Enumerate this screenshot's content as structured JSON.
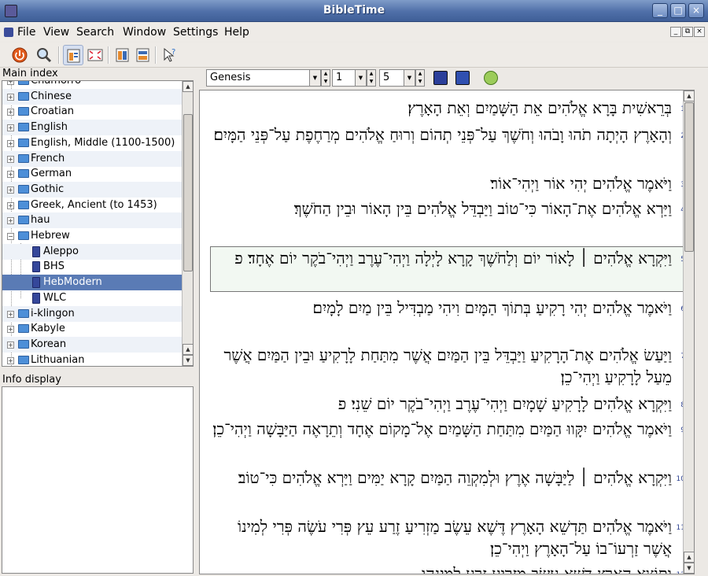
{
  "window": {
    "title": "BibleTime",
    "btn_min": "_",
    "btn_max": "□",
    "btn_close": "×"
  },
  "menubar": {
    "items": [
      "File",
      "View",
      "Search",
      "Window",
      "Settings",
      "Help"
    ],
    "mdi": [
      "_",
      "⧉",
      "×"
    ]
  },
  "main_index": {
    "label": "Main index",
    "items": [
      {
        "label": "Chamorro",
        "type": "folder"
      },
      {
        "label": "Chinese",
        "type": "folder"
      },
      {
        "label": "Croatian",
        "type": "folder"
      },
      {
        "label": "English",
        "type": "folder"
      },
      {
        "label": "English, Middle (1100-1500)",
        "type": "folder"
      },
      {
        "label": "French",
        "type": "folder"
      },
      {
        "label": "German",
        "type": "folder"
      },
      {
        "label": "Gothic",
        "type": "folder"
      },
      {
        "label": "Greek, Ancient (to 1453)",
        "type": "folder"
      },
      {
        "label": "hau",
        "type": "folder"
      },
      {
        "label": "Hebrew",
        "type": "folder",
        "expanded": true
      },
      {
        "label": "Aleppo",
        "type": "module"
      },
      {
        "label": "BHS",
        "type": "module"
      },
      {
        "label": "HebModern",
        "type": "module",
        "selected": true
      },
      {
        "label": "WLC",
        "type": "module"
      },
      {
        "label": "i-klingon",
        "type": "folder"
      },
      {
        "label": "Kabyle",
        "type": "folder"
      },
      {
        "label": "Korean",
        "type": "folder"
      },
      {
        "label": "Lithuanian",
        "type": "folder"
      }
    ]
  },
  "info_display": {
    "label": "Info display"
  },
  "navigation": {
    "book": "Genesis",
    "chapter": "1",
    "verse": "5"
  },
  "verses": [
    {
      "n": "1",
      "text": "בְּרֵאשִׁית בָּרָא אֱלֹהִים אֵת הַשָּׁמַיִם וְאֵת הָאָרֶץ׃"
    },
    {
      "n": "2",
      "text": "וְהָאָרֶץ הָיְתָה תֹהוּ וָבֹהוּ וְחֹשֶׁךְ עַל־פְּנֵי תְהוֹם וְרוּחַ אֱלֹהִים מְרַחֶפֶת עַל־פְּנֵי הַמָּיִם׃"
    },
    {
      "n": "3",
      "text": "וַיֹּאמֶר אֱלֹהִים יְהִי אוֹר וַיְהִי־אוֹר׃"
    },
    {
      "n": "4",
      "text": "וַיַּרְא אֱלֹהִים אֶת־הָאוֹר כִּי־טוֹב וַיַּבְדֵּל אֱלֹהִים בֵּין הָאוֹר וּבֵין הַחֹשֶׁךְ׃"
    },
    {
      "n": "5",
      "text": "וַיִּקְרָא אֱלֹהִים ׀ לָאוֹר יוֹם וְלַחֹשֶׁךְ קָרָא לָיְלָה וַיְהִי־עֶרֶב וַיְהִי־בֹקֶר יוֹם אֶחָד׃ פ"
    },
    {
      "n": "6",
      "text": "וַיֹּאמֶר אֱלֹהִים יְהִי רָקִיעַ בְּתוֹךְ הַמָּיִם וִיהִי מַבְדִּיל בֵּין מַיִם לָמָיִם׃"
    },
    {
      "n": "7",
      "text": "וַיַּעַשׂ אֱלֹהִים אֶת־הָרָקִיעַ וַיַּבְדֵּל בֵּין הַמַּיִם אֲשֶׁר מִתַּחַת לָרָקִיעַ וּבֵין הַמַּיִם אֲשֶׁר מֵעַל לָרָקִיעַ וַיְהִי־כֵן׃"
    },
    {
      "n": "8",
      "text": "וַיִּקְרָא אֱלֹהִים לָרָקִיעַ שָׁמָיִם וַיְהִי־עֶרֶב וַיְהִי־בֹקֶר יוֹם שֵׁנִי׃ פ"
    },
    {
      "n": "9",
      "text": "וַיֹּאמֶר אֱלֹהִים יִקָּווּ הַמַּיִם מִתַּחַת הַשָּׁמַיִם אֶל־מָקוֹם אֶחָד וְתֵרָאֶה הַיַּבָּשָׁה וַיְהִי־כֵן׃"
    },
    {
      "n": "10",
      "text": "וַיִּקְרָא אֱלֹהִים ׀ לַיַּבָּשָׁה אֶרֶץ וּלְמִקְוֵה הַמַּיִם קָרָא יַמִּים וַיַּרְא אֱלֹהִים כִּי־טוֹב׃"
    },
    {
      "n": "11",
      "text": "וַיֹּאמֶר אֱלֹהִים תַּדְשֵׁא הָאָרֶץ דֶּשֶׁא עֵשֶׂב מַזְרִיעַ זֶרַע עֵץ פְּרִי עֹשֶׂה פְּרִי לְמִינוֹ אֲשֶׁר זַרְעוֹ־בוֹ עַל־הָאָרֶץ וַיְהִי־כֵן׃"
    },
    {
      "n": "12",
      "text": "וַתּוֹצֵא הָאָרֶץ דֶּשֶׁא עֵשֶׂב מַזְרִיעַ זֶרַע לְמִינֵהוּ"
    }
  ]
}
